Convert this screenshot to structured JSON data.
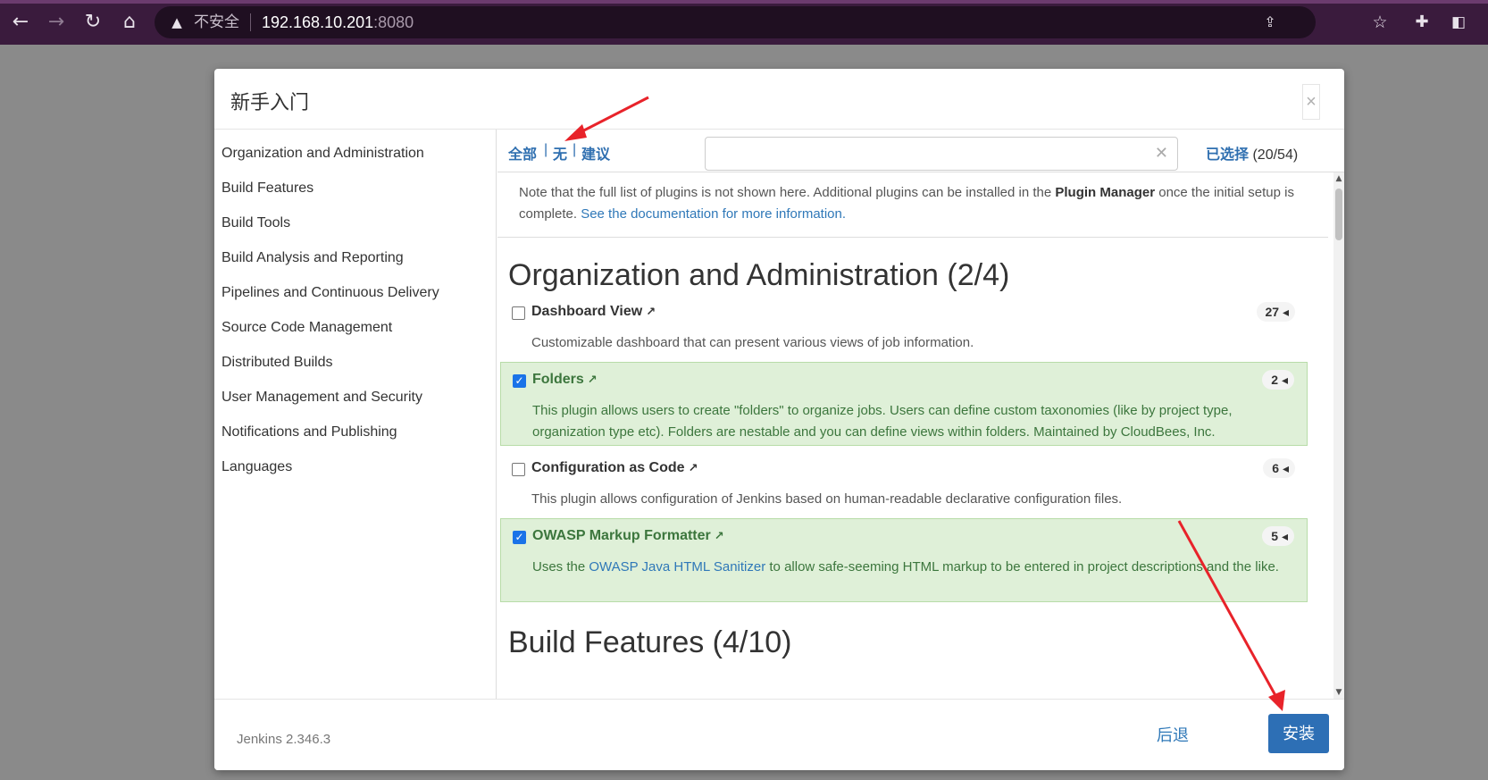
{
  "browser": {
    "security_label": "不安全",
    "url_host": "192.168.10.201",
    "url_port": ":8080"
  },
  "dialog": {
    "title": "新手入门",
    "close_glyph": "×"
  },
  "sidebar": {
    "items": [
      {
        "label": "Organization and Administration"
      },
      {
        "label": "Build Features"
      },
      {
        "label": "Build Tools"
      },
      {
        "label": "Build Analysis and Reporting"
      },
      {
        "label": "Pipelines and Continuous Delivery"
      },
      {
        "label": "Source Code Management"
      },
      {
        "label": "Distributed Builds"
      },
      {
        "label": "User Management and Security"
      },
      {
        "label": "Notifications and Publishing"
      },
      {
        "label": "Languages"
      }
    ]
  },
  "toolbar": {
    "filter_all": "全部",
    "filter_none": "无",
    "filter_suggested": "建议",
    "separator": "|",
    "search_value": "",
    "selected_label": "已选择",
    "selected_count": "(20/54)"
  },
  "note": {
    "text_before": "Note that the full list of plugins is not shown here. Additional plugins can be installed in the ",
    "plugin_manager": "Plugin Manager",
    "text_after": " once the initial setup is complete. ",
    "doc_link": "See the documentation for more information."
  },
  "sections": [
    {
      "title": "Organization and Administration (2/4)",
      "plugins": [
        {
          "name": "Dashboard View",
          "count": "27",
          "checked": false,
          "desc": "Customizable dashboard that can present various views of job information."
        },
        {
          "name": "Folders",
          "count": "2",
          "checked": true,
          "desc": "This plugin allows users to create \"folders\" to organize jobs. Users can define custom taxonomies (like by project type, organization type etc). Folders are nestable and you can define views within folders. Maintained by CloudBees, Inc."
        },
        {
          "name": "Configuration as Code",
          "count": "6",
          "checked": false,
          "desc": "This plugin allows configuration of Jenkins based on human-readable declarative configuration files."
        },
        {
          "name": "OWASP Markup Formatter",
          "count": "5",
          "checked": true,
          "desc_before": "Uses the ",
          "desc_link": "OWASP Java HTML Sanitizer",
          "desc_after": " to allow safe-seeming HTML markup to be entered in project descriptions and the like."
        }
      ]
    },
    {
      "title": "Build Features (4/10)"
    }
  ],
  "footer": {
    "version": "Jenkins 2.346.3",
    "back_label": "后退",
    "install_label": "安装"
  },
  "colors": {
    "accent": "#2d6fb5",
    "selected_bg": "#dff0d8",
    "selected_text": "#3c763d",
    "annotation": "#e8232a"
  }
}
